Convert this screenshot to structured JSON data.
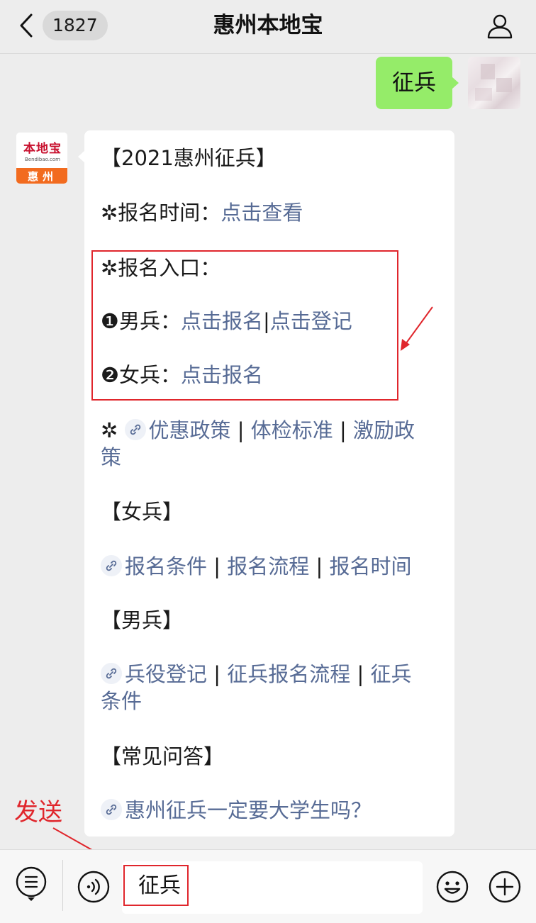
{
  "header": {
    "back_count": "1827",
    "title": "惠州本地宝"
  },
  "outgoing_message": {
    "text": "征兵"
  },
  "bot": {
    "logo_main": "本地宝",
    "logo_sub": "Bendibao.com",
    "logo_city": "惠州"
  },
  "message": {
    "heading": "【2021惠州征兵】",
    "reg_time_label": "✲报名时间：",
    "reg_time_link": "点击查看",
    "reg_entry_label": "✲报名入口：",
    "male_label": "❶男兵：",
    "male_link1": "点击报名",
    "male_sep": "|",
    "male_link2": "点击登记",
    "female_label": "❷女兵：",
    "female_link": "点击报名",
    "policy_prefix": "✲",
    "policy_link1": "优惠政策",
    "policy_sep1": " | ",
    "policy_link2": "体检标准",
    "policy_sep2": " | ",
    "policy_link3a": "激励政",
    "policy_link3b": "策",
    "female_section": "【女兵】",
    "female_link1": "报名条件",
    "female_sep1": " | ",
    "female_link2": "报名流程",
    "female_sep2": " | ",
    "female_link3": "报名时间",
    "male_section": "【男兵】",
    "male_sec_link1": "兵役登记",
    "male_sec_sep1": " | ",
    "male_sec_link2": "征兵报名流程",
    "male_sec_sep2": " | ",
    "male_sec_link3a": "征兵",
    "male_sec_link3b": "条件",
    "faq_section": "【常见问答】",
    "faq_link": "惠州征兵一定要大学生吗？"
  },
  "annotation": {
    "send_label": "发送",
    "color": "#e0262c"
  },
  "input": {
    "value": "征兵"
  },
  "colors": {
    "link": "#576b95",
    "outgoing_bubble": "#95ec69",
    "background": "#ededed"
  },
  "icons": [
    "back-arrow-icon",
    "profile-icon",
    "link-icon",
    "menu-list-icon",
    "voice-icon",
    "emoji-icon",
    "plus-icon"
  ]
}
